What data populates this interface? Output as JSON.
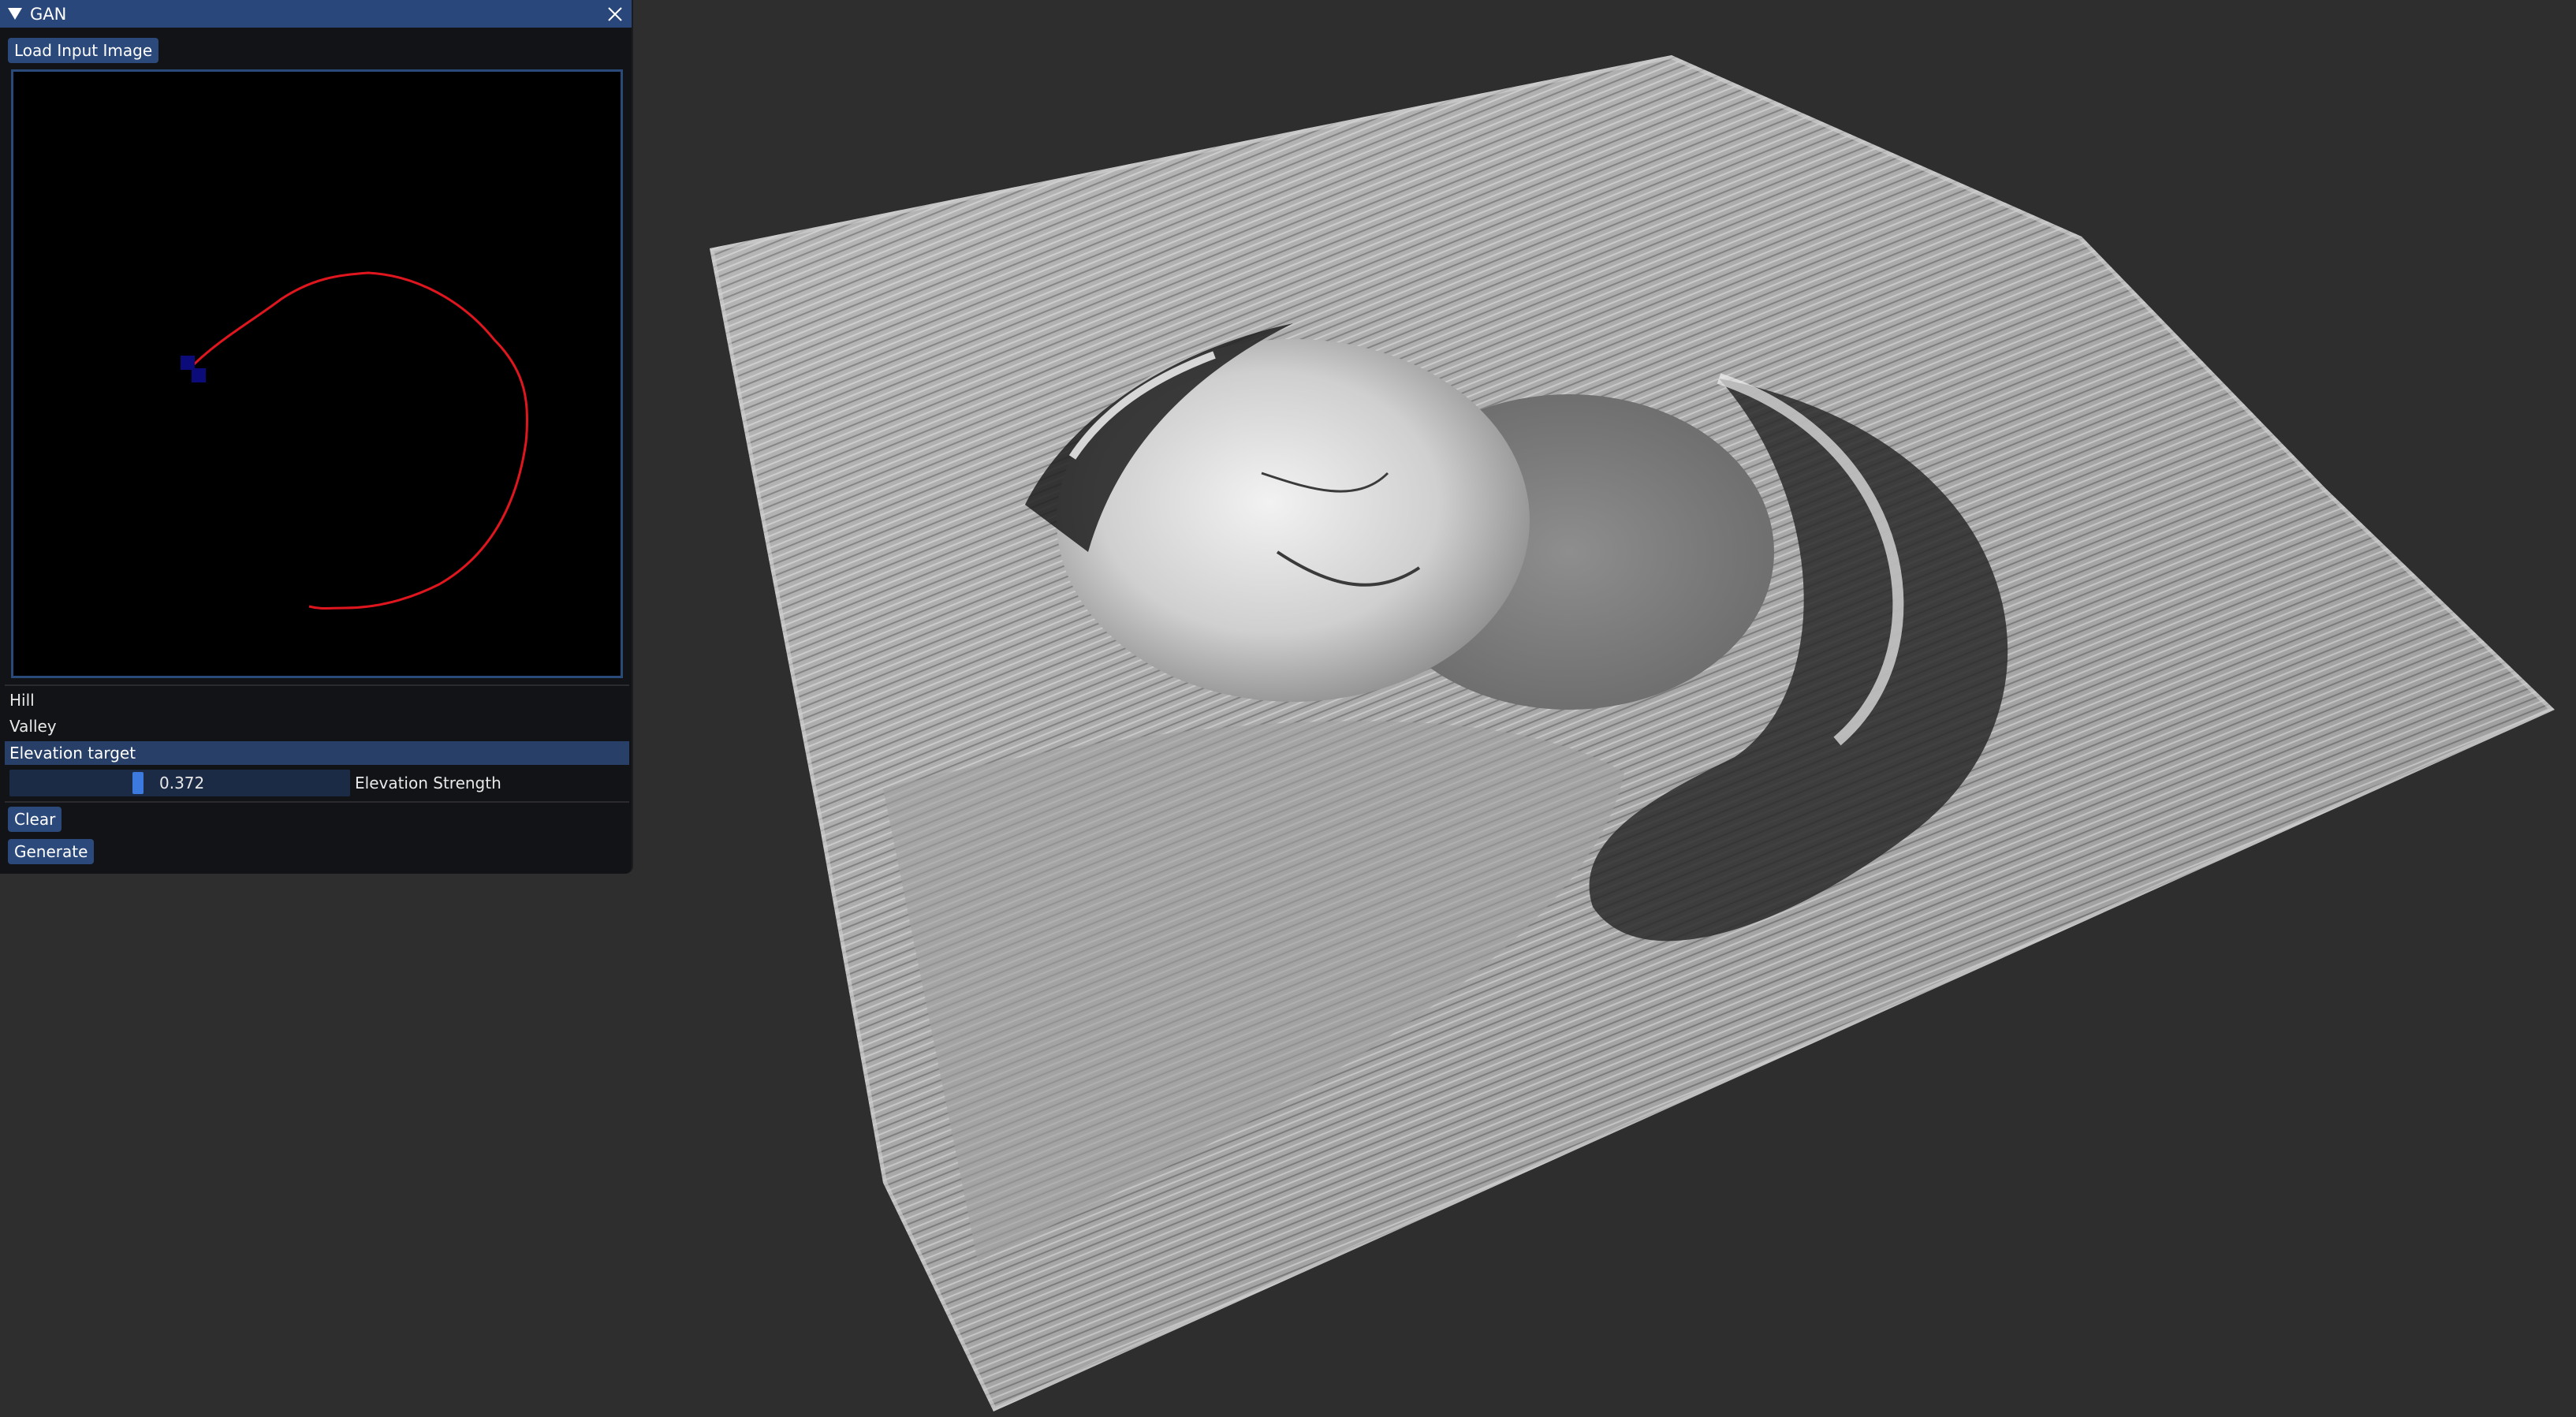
{
  "window": {
    "title": "GAN",
    "load_button": "Load Input Image",
    "labels": {
      "hill": "Hill",
      "valley": "Valley",
      "elevation_target": "Elevation target"
    },
    "slider": {
      "value": "0.372",
      "label": "Elevation Strength",
      "level": 0.372
    },
    "buttons": {
      "clear": "Clear",
      "generate": "Generate"
    }
  },
  "icons": [
    "collapse-arrow-icon",
    "close-icon"
  ],
  "colors": {
    "title_bar": "#29477a",
    "button": "#2b4a7b",
    "stroke": "#e0161e",
    "marker": "#0b0b7a",
    "viewport_bg": "#2e2e2e"
  }
}
